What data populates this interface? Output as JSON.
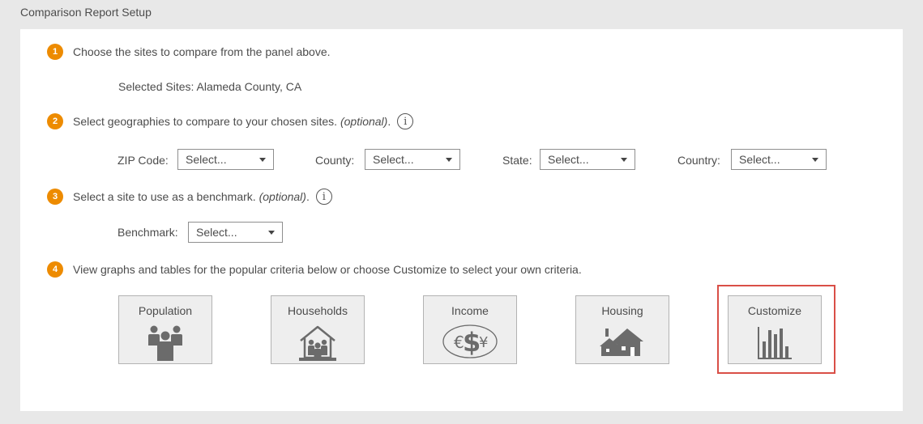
{
  "page": {
    "title": "Comparison Report Setup"
  },
  "colors": {
    "step_badge": "#ed8b00",
    "highlight": "#d94f47",
    "icon": "#6b6b6b"
  },
  "steps": [
    {
      "number": "1",
      "text": "Choose the sites to compare from the panel above.",
      "optional": ""
    },
    {
      "number": "2",
      "text": "Select geographies to compare to your chosen sites.",
      "optional": "(optional)",
      "suffix": "."
    },
    {
      "number": "3",
      "text": "Select a site to use as a benchmark.",
      "optional": "(optional)",
      "suffix": "."
    },
    {
      "number": "4",
      "text": "View graphs and tables for the popular criteria below or choose Customize to select your own criteria.",
      "optional": ""
    }
  ],
  "selected_sites": "Selected Sites: Alameda County, CA",
  "info_icon_glyph": "i",
  "geographies": {
    "zip": {
      "label": "ZIP Code:",
      "value": "Select..."
    },
    "county": {
      "label": "County:",
      "value": "Select..."
    },
    "state": {
      "label": "State:",
      "value": "Select..."
    },
    "country": {
      "label": "Country:",
      "value": "Select..."
    }
  },
  "benchmark": {
    "label": "Benchmark:",
    "value": "Select..."
  },
  "tiles": [
    {
      "label": "Population",
      "icon": "population-icon"
    },
    {
      "label": "Households",
      "icon": "households-icon"
    },
    {
      "label": "Income",
      "icon": "income-icon"
    },
    {
      "label": "Housing",
      "icon": "housing-icon"
    },
    {
      "label": "Customize",
      "icon": "bar-chart-icon",
      "highlighted": true
    }
  ],
  "income_glyphs": {
    "euro": "€",
    "dollar": "$",
    "yen": "¥"
  }
}
